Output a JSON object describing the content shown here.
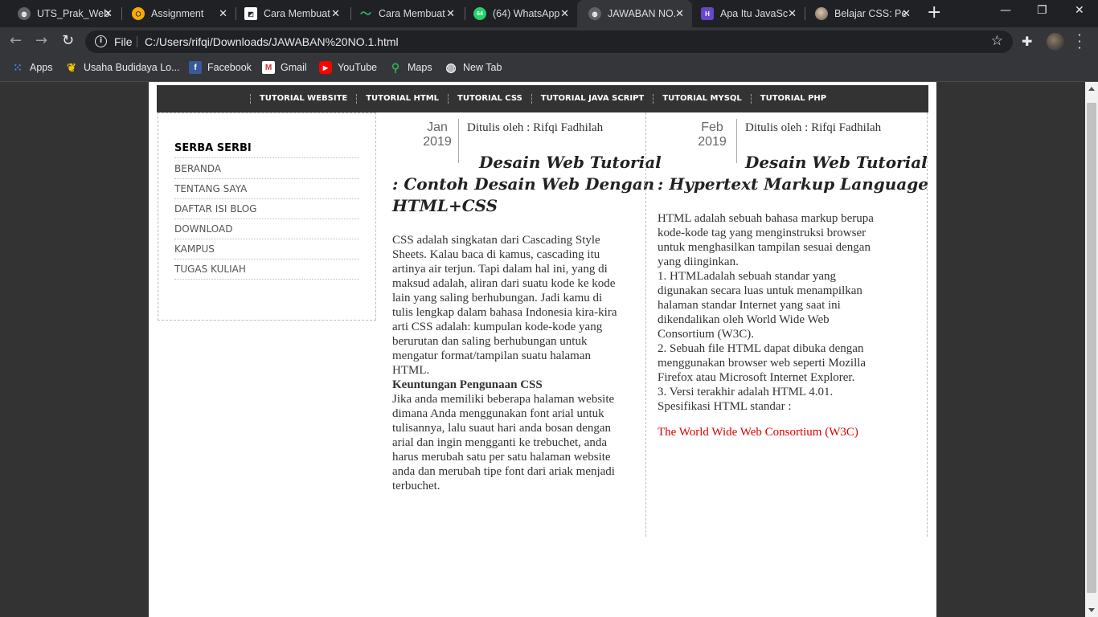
{
  "browser": {
    "tabs": [
      {
        "label": "UTS_Prak_Web",
        "icon": "globe-icon",
        "color": "#5f6368"
      },
      {
        "label": "Assignment",
        "icon": "shield-icon",
        "color": "#f9ab00"
      },
      {
        "label": "Cara Membuat",
        "icon": "chart-icon",
        "color": "#ffffff"
      },
      {
        "label": "Cara Membuat",
        "icon": "wave-icon",
        "color": "#2bb673"
      },
      {
        "label": "(64) WhatsApp",
        "icon": "whatsapp-icon",
        "color": "#25d366",
        "badge": "64"
      },
      {
        "label": "JAWABAN NO.",
        "icon": "globe-icon",
        "color": "#5f6368"
      },
      {
        "label": "Apa Itu JavaSc",
        "icon": "h-logo-icon",
        "color": "#6747c7"
      },
      {
        "label": "Belajar CSS: Pe",
        "icon": "avatar-icon",
        "color": "#8a7a6a"
      }
    ],
    "new_tab_symbol": "+",
    "window_controls": {
      "minimize": "—",
      "maximize": "❐",
      "close": "✕"
    },
    "nav": {
      "back": "←",
      "forward": "→",
      "reload": "↻"
    },
    "address": {
      "scheme": "File",
      "url": "C:/Users/rifqi/Downloads/JAWABAN%20NO.1.html",
      "info_icon": "i"
    },
    "bookmarks": [
      {
        "label": "Apps",
        "icon": "apps-grid-icon"
      },
      {
        "label": "Usaha Budidaya Lo...",
        "icon": "leaf-icon"
      },
      {
        "label": "Facebook",
        "icon": "facebook-icon"
      },
      {
        "label": "Gmail",
        "icon": "gmail-icon"
      },
      {
        "label": "YouTube",
        "icon": "youtube-icon"
      },
      {
        "label": "Maps",
        "icon": "maps-pin-icon"
      },
      {
        "label": "New Tab",
        "icon": "globe-icon"
      }
    ]
  },
  "page": {
    "nav_items": [
      "TUTORIAL WEBSITE",
      "TUTORIAL HTML",
      "TUTORIAL CSS",
      "TUTORIAL JAVA SCRIPT",
      "TUTORIAL MYSQL",
      "TUTORIAL PHP"
    ],
    "sidebar": {
      "heading": "SERBA SERBI",
      "items": [
        "BERANDA",
        "TENTANG SAYA",
        "DAFTAR ISI BLOG",
        "DOWNLOAD",
        "KAMPUS",
        "TUGAS KULIAH"
      ]
    },
    "posts": [
      {
        "month": "Jan",
        "year": "2019",
        "author": "Ditulis oleh : Rifqi Fadhilah",
        "title_lines": [
          "Desain Web Tutorial",
          ": Contoh Desain Web Dengan",
          "HTML+CSS"
        ],
        "body_lines": [
          "CSS adalah singkatan dari Cascading Style",
          "Sheets. Kalau baca di kamus, cascading itu",
          "artinya air terjun. Tapi dalam hal ini, yang di",
          "maksud adalah, aliran dari suatu kode ke kode",
          "lain yang saling berhubungan. Jadi kamu di",
          "tulis lengkap dalam bahasa Indonesia kira-kira",
          "arti CSS adalah: kumpulan kode-kode yang",
          "berurutan dan saling berhubungan untuk",
          "mengatur format/tampilan suatu halaman",
          "HTML."
        ],
        "subheading": "Keuntungan Pengunaan CSS",
        "body2_lines": [
          "Jika anda memiliki beberapa halaman website",
          "dimana Anda menggunakan font arial untuk",
          "tulisannya, lalu suaut hari anda bosan dengan",
          "arial dan ingin mengganti ke trebuchet, anda",
          "harus merubah satu per satu halaman website",
          "anda dan merubah tipe font dari ariak menjadi",
          "terbuchet."
        ]
      },
      {
        "month": "Feb",
        "year": "2019",
        "author": "Ditulis oleh : Rifqi Fadhilah",
        "title_lines": [
          "Desain Web Tutorial",
          ": Hypertext Markup Language"
        ],
        "body_lines": [
          "HTML adalah sebuah bahasa markup berupa",
          "kode-kode tag yang menginstruksi browser",
          "untuk menghasilkan tampilan sesuai dengan",
          "yang diinginkan.",
          "1. HTMLadalah sebuah standar yang",
          "digunakan secara luas untuk menampilkan",
          "halaman standar Internet yang saat ini",
          "dikendalikan oleh World Wide Web",
          "Consortium (W3C).",
          "2. Sebuah file HTML dapat dibuka dengan",
          "menggunakan browser web seperti Mozilla",
          "Firefox atau Microsoft Internet Explorer.",
          "3. Versi terakhir adalah HTML 4.01.",
          "Spesifikasi HTML standar :"
        ],
        "link": "The World Wide Web Consortium (W3C)",
        "link_color": "#dd0000"
      }
    ]
  }
}
